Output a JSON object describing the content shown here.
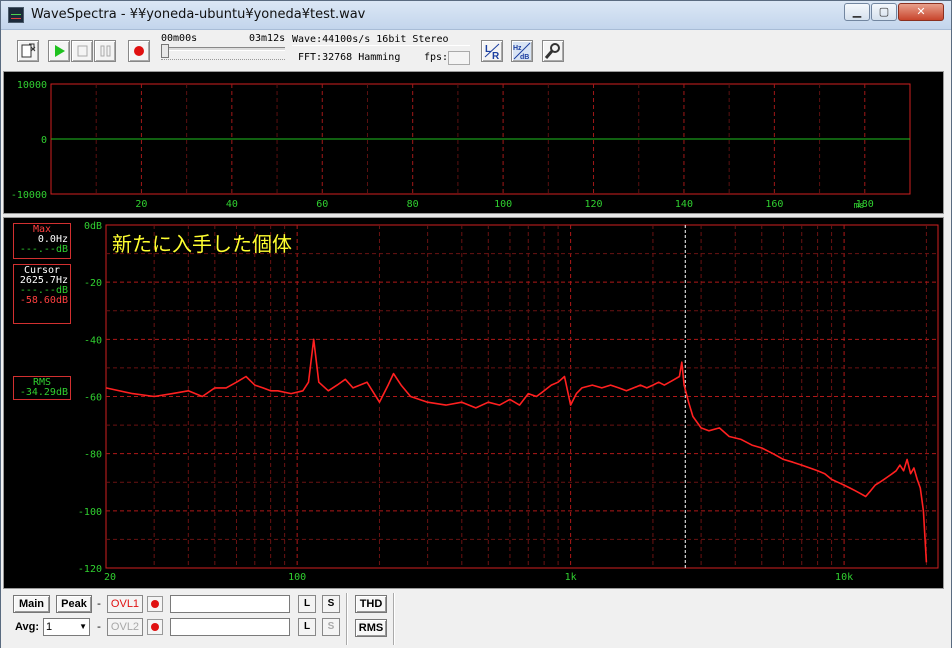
{
  "window": {
    "title": "WaveSpectra - ¥¥yoneda-ubuntu¥yoneda¥test.wav",
    "min_label": "▁",
    "max_label": "▢",
    "close_label": "✕"
  },
  "toolbar": {
    "time_start": "00m00s",
    "time_end": "03m12s",
    "wave_info": "Wave:44100s/s 16bit Stereo",
    "fft_info": "FFT:32768 Hamming",
    "fps_label": "fps:",
    "seek_position_fraction": 0.0
  },
  "waveform": {
    "y_ticks": [
      "10000",
      "0",
      "-10000"
    ],
    "x_ticks": [
      "20",
      "40",
      "60",
      "80",
      "100",
      "120",
      "140",
      "160",
      "180"
    ],
    "x_unit": "ms",
    "y_range": [
      -10000,
      10000
    ],
    "x_range": [
      0,
      190
    ]
  },
  "spectrum": {
    "annotation": "新たに入手した個体",
    "max_box": {
      "title": "Max",
      "freq": "0.0Hz",
      "level": "---.--dB"
    },
    "cursor_box": {
      "title": "Cursor",
      "freq": "2625.7Hz",
      "level_a": "---.--dB",
      "level_b": "-58.60dB"
    },
    "rms_box": {
      "title": "RMS",
      "level": "-34.29dB"
    },
    "cursor_freq_hz": 2625.7
  },
  "chart_data": {
    "type": "line",
    "xlabel": "",
    "ylabel": "",
    "x_scale": "log",
    "xlim": [
      20,
      22050
    ],
    "ylim": [
      -120,
      0
    ],
    "x_tick_labels": [
      "20",
      "100",
      "1k",
      "10k"
    ],
    "y_tick_labels": [
      "0dB",
      "-20",
      "-40",
      "-60",
      "-80",
      "-100",
      "-120"
    ],
    "grid": true,
    "series": [
      {
        "color": "#ff2020",
        "points": [
          [
            20,
            -57
          ],
          [
            25,
            -59
          ],
          [
            30,
            -60
          ],
          [
            35,
            -59
          ],
          [
            40,
            -58
          ],
          [
            45,
            -60
          ],
          [
            50,
            -57
          ],
          [
            55,
            -57
          ],
          [
            60,
            -55
          ],
          [
            65,
            -53
          ],
          [
            70,
            -56
          ],
          [
            75,
            -57
          ],
          [
            80,
            -58
          ],
          [
            85,
            -58
          ],
          [
            95,
            -59
          ],
          [
            105,
            -58
          ],
          [
            110,
            -55
          ],
          [
            115,
            -40
          ],
          [
            120,
            -55
          ],
          [
            130,
            -58
          ],
          [
            140,
            -56
          ],
          [
            150,
            -54
          ],
          [
            160,
            -57
          ],
          [
            180,
            -55
          ],
          [
            200,
            -62
          ],
          [
            215,
            -56
          ],
          [
            225,
            -52
          ],
          [
            240,
            -56
          ],
          [
            260,
            -60
          ],
          [
            300,
            -62
          ],
          [
            350,
            -63
          ],
          [
            400,
            -62
          ],
          [
            450,
            -64
          ],
          [
            500,
            -62
          ],
          [
            550,
            -63
          ],
          [
            600,
            -61
          ],
          [
            650,
            -63
          ],
          [
            700,
            -59
          ],
          [
            750,
            -60
          ],
          [
            800,
            -58
          ],
          [
            850,
            -56
          ],
          [
            900,
            -55
          ],
          [
            950,
            -53
          ],
          [
            1000,
            -63
          ],
          [
            1050,
            -59
          ],
          [
            1100,
            -57
          ],
          [
            1200,
            -56
          ],
          [
            1300,
            -57
          ],
          [
            1400,
            -56
          ],
          [
            1500,
            -57
          ],
          [
            1600,
            -58
          ],
          [
            1700,
            -57
          ],
          [
            1800,
            -56
          ],
          [
            1900,
            -57
          ],
          [
            2000,
            -56
          ],
          [
            2100,
            -55
          ],
          [
            2200,
            -56
          ],
          [
            2300,
            -55
          ],
          [
            2400,
            -54
          ],
          [
            2500,
            -53
          ],
          [
            2550,
            -48
          ],
          [
            2600,
            -56
          ],
          [
            2700,
            -62
          ],
          [
            2800,
            -67
          ],
          [
            3000,
            -71
          ],
          [
            3200,
            -72
          ],
          [
            3500,
            -71
          ],
          [
            3800,
            -74
          ],
          [
            4200,
            -75
          ],
          [
            4600,
            -77
          ],
          [
            5000,
            -78
          ],
          [
            5500,
            -80
          ],
          [
            6000,
            -82
          ],
          [
            6500,
            -83
          ],
          [
            7000,
            -84
          ],
          [
            7500,
            -85
          ],
          [
            8000,
            -86
          ],
          [
            8500,
            -87
          ],
          [
            9000,
            -89
          ],
          [
            9500,
            -90
          ],
          [
            10000,
            -91
          ],
          [
            10500,
            -92
          ],
          [
            11000,
            -93
          ],
          [
            11500,
            -94
          ],
          [
            12000,
            -95
          ],
          [
            12500,
            -93
          ],
          [
            13000,
            -91
          ],
          [
            13500,
            -90
          ],
          [
            14000,
            -89
          ],
          [
            14500,
            -88
          ],
          [
            15000,
            -87
          ],
          [
            15500,
            -86
          ],
          [
            16000,
            -84
          ],
          [
            16500,
            -86
          ],
          [
            17000,
            -82
          ],
          [
            17500,
            -87
          ],
          [
            18000,
            -85
          ],
          [
            18500,
            -89
          ],
          [
            19000,
            -92
          ],
          [
            19500,
            -100
          ],
          [
            20000,
            -118
          ]
        ]
      }
    ]
  }
}
